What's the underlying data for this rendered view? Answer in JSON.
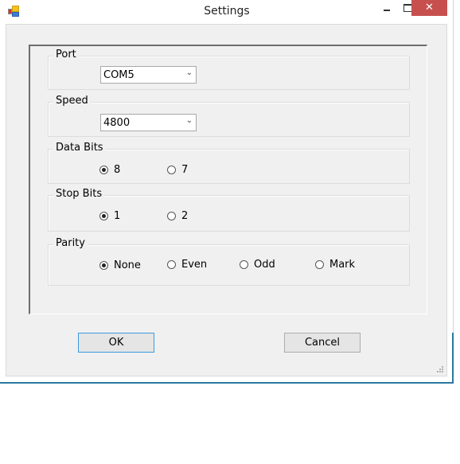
{
  "window": {
    "title": "Settings",
    "icons": {
      "app": "app-icon",
      "minimize": "minimize-icon",
      "maximize": "maximize-icon",
      "close": "close-icon"
    },
    "close_glyph": "✕",
    "accent_color": "#2b79a0",
    "close_color": "#c7504f"
  },
  "groups": {
    "port": {
      "label": "Port",
      "value": "COM5"
    },
    "speed": {
      "label": "Speed",
      "value": "4800"
    },
    "data_bits": {
      "label": "Data Bits",
      "options": [
        "8",
        "7"
      ],
      "selected": "8"
    },
    "stop_bits": {
      "label": "Stop Bits",
      "options": [
        "1",
        "2"
      ],
      "selected": "1"
    },
    "parity": {
      "label": "Parity",
      "options": [
        "None",
        "Even",
        "Odd",
        "Mark"
      ],
      "selected": "None"
    }
  },
  "buttons": {
    "ok": "OK",
    "cancel": "Cancel"
  },
  "combo_chevron": "⌄"
}
